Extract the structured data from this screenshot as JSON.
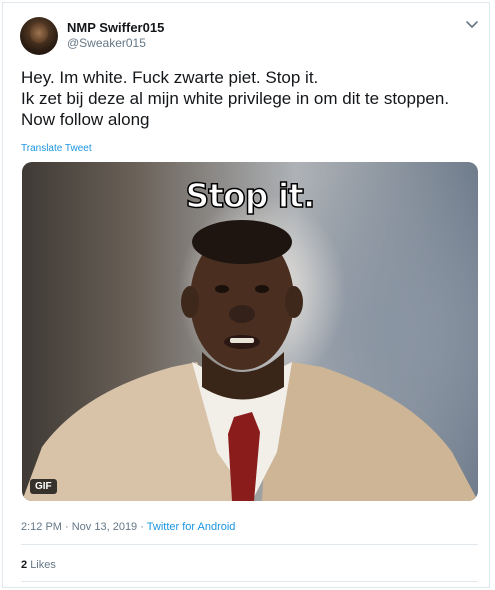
{
  "tweet": {
    "author": {
      "display_name": "NMP Swiffer015",
      "handle": "@Sweaker015"
    },
    "text_lines": [
      "Hey. Im white. Fuck zwarte piet. Stop it.",
      "Ik zet bij deze al mijn white privilege in om dit te stoppen.",
      "Now follow along"
    ],
    "translate_label": "Translate Tweet",
    "media": {
      "caption": "Stop it.",
      "badge": "GIF"
    },
    "timestamp": "2:12 PM · Nov 13, 2019",
    "separator": " · ",
    "source": "Twitter for Android",
    "likes_count": "2",
    "likes_label": "Likes"
  },
  "colors": {
    "link": "#1b95e0",
    "secondary_text": "#657786",
    "primary_text": "#14171a",
    "border": "#e1e8ed"
  },
  "icons": {
    "menu": "chevron-down-icon"
  }
}
